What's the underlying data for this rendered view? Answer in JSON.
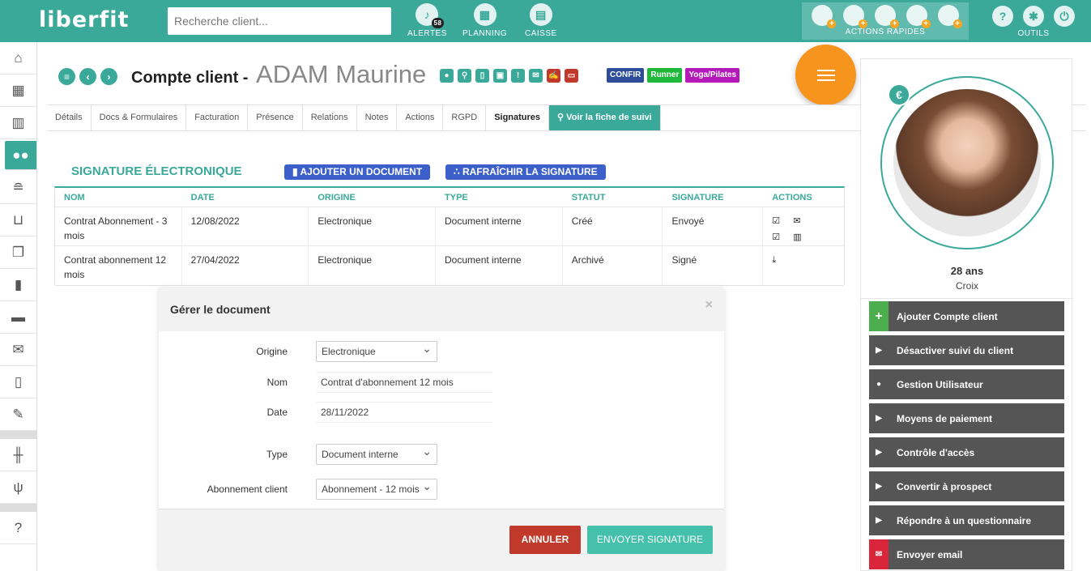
{
  "topbar": {
    "logo": "liberfit",
    "search_placeholder": "Recherche client...",
    "alertes_label": "ALERTES",
    "alertes_count": "58",
    "planning_label": "PLANNING",
    "caisse_label": "CAISSE",
    "actions_rapides_label": "ACTIONS RAPIDES",
    "outils_label": "OUTILS"
  },
  "header": {
    "title_prefix": "Compte client -",
    "client_name": "ADAM Maurine",
    "tags": [
      {
        "label": "CONFIR",
        "color": "#2d4c9a"
      },
      {
        "label": "Runner",
        "color": "#1fb83a"
      },
      {
        "label": "Yoga/Pilates",
        "color": "#b419b9"
      }
    ]
  },
  "tabs": [
    "Détails",
    "Docs & Formulaires",
    "Facturation",
    "Présence",
    "Relations",
    "Notes",
    "Actions",
    "RGPD",
    "Signatures",
    "Voir la fiche de suivi"
  ],
  "signature": {
    "title": "SIGNATURE ÉLECTRONIQUE",
    "add_doc": "AJOUTER UN DOCUMENT",
    "refresh": "RAFRAÎCHIR LA SIGNATURE",
    "columns": [
      "NOM",
      "DATE",
      "ORIGINE",
      "TYPE",
      "STATUT",
      "SIGNATURE",
      "ACTIONS"
    ],
    "rows": [
      {
        "nom": "Contrat Abonnement - 3 mois",
        "date": "12/08/2022",
        "origine": "Electronique",
        "type": "Document interne",
        "statut": "Créé",
        "signature": "Envoyé"
      },
      {
        "nom": "Contrat abonnement 12 mois",
        "date": "27/04/2022",
        "origine": "Electronique",
        "type": "Document interne",
        "statut": "Archivé",
        "signature": "Signé"
      }
    ]
  },
  "modal": {
    "title": "Gérer le document",
    "close": "×",
    "origine_label": "Origine",
    "origine_value": "Electronique",
    "nom_label": "Nom",
    "nom_value": "Contrat d'abonnement 12 mois",
    "date_label": "Date",
    "date_value": "28/11/2022",
    "type_label": "Type",
    "type_value": "Document interne",
    "abonnement_label": "Abonnement client",
    "abonnement_value": "Abonnement - 12 mois",
    "cancel": "ANNULER",
    "send": "ENVOYER SIGNATURE"
  },
  "profile": {
    "age": "28 ans",
    "city": "Croix",
    "actions": [
      "Ajouter Compte client",
      "Désactiver suivi du client",
      "Gestion Utilisateur",
      "Moyens de paiement",
      "Contrôle d'accès",
      "Convertir à prospect",
      "Répondre à un questionnaire",
      "Envoyer email"
    ]
  },
  "colors": {
    "brand": "#3aa99a",
    "accent_orange": "#f7941d",
    "blue_button": "#3d5fc9",
    "danger": "#c0392b"
  }
}
